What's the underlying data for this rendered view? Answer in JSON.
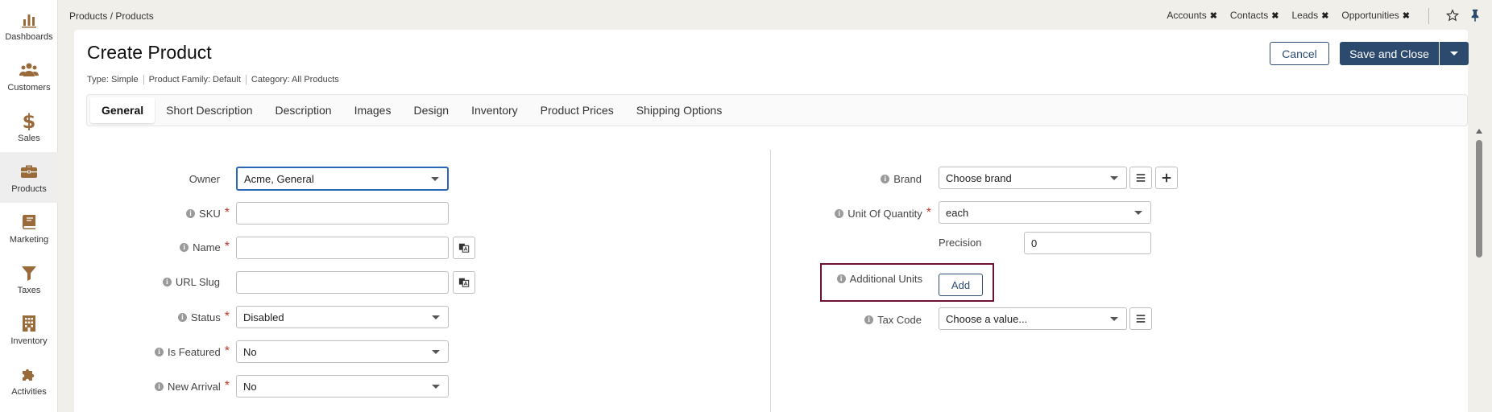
{
  "sidebar": {
    "items": [
      {
        "label": "Dashboards",
        "icon": "bar-chart-icon"
      },
      {
        "label": "Customers",
        "icon": "users-icon"
      },
      {
        "label": "Sales",
        "icon": "dollar-icon"
      },
      {
        "label": "Products",
        "icon": "briefcase-icon"
      },
      {
        "label": "Marketing",
        "icon": "book-icon"
      },
      {
        "label": "Taxes",
        "icon": "filter-icon"
      },
      {
        "label": "Inventory",
        "icon": "building-icon"
      },
      {
        "label": "Activities",
        "icon": "puzzle-icon"
      }
    ],
    "active": "Products",
    "icon_color": "#9a6b3a"
  },
  "topbar": {
    "breadcrumb": "Products / Products",
    "pins": [
      "Accounts",
      "Contacts",
      "Leads",
      "Opportunities"
    ]
  },
  "header": {
    "title": "Create Product",
    "meta": [
      "Type: Simple",
      "Product Family: Default",
      "Category: All Products"
    ],
    "cancel_label": "Cancel",
    "save_label": "Save and Close"
  },
  "tabs": [
    "General",
    "Short Description",
    "Description",
    "Images",
    "Design",
    "Inventory",
    "Product Prices",
    "Shipping Options"
  ],
  "form_left": {
    "owner": {
      "label": "Owner",
      "value": "Acme, General"
    },
    "sku": {
      "label": "SKU",
      "value": ""
    },
    "name": {
      "label": "Name",
      "value": ""
    },
    "url_slug": {
      "label": "URL Slug",
      "value": ""
    },
    "status": {
      "label": "Status",
      "value": "Disabled"
    },
    "is_featured": {
      "label": "Is Featured",
      "value": "No"
    },
    "new_arrival": {
      "label": "New Arrival",
      "value": "No"
    }
  },
  "form_right": {
    "brand": {
      "label": "Brand",
      "value": "Choose brand"
    },
    "unit_of_quantity": {
      "label": "Unit Of Quantity",
      "value": "each"
    },
    "precision": {
      "label": "Precision",
      "value": "0"
    },
    "additional_units": {
      "label": "Additional Units",
      "button": "Add"
    },
    "tax_code": {
      "label": "Tax Code",
      "value": "Choose a value..."
    }
  },
  "colors": {
    "primary": "#2c4a6e",
    "highlight_border": "#6d1234",
    "required": "#c0392b"
  }
}
